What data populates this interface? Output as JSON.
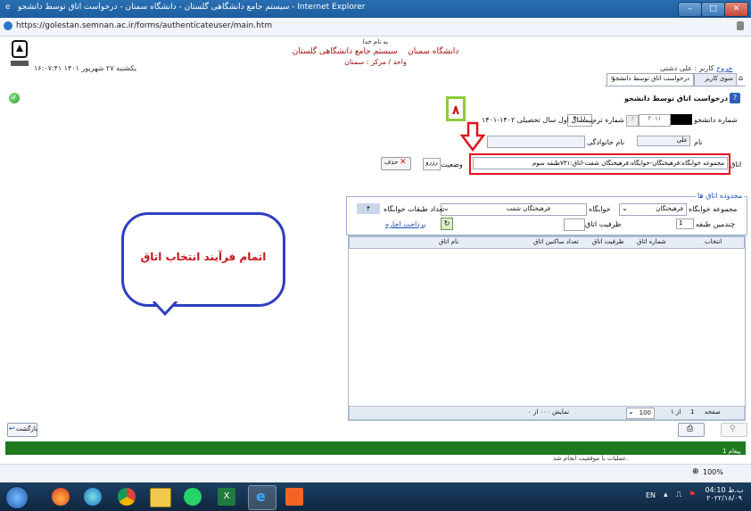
{
  "window": {
    "title": "سیستم جامع دانشگاهی گلستان - دانشگاه سمنان - درخواست اتاق توسط دانشجو - Internet Explorer",
    "url": "https://golestan.semnan.ac.ir/forms/authenticateuser/main.htm",
    "url_host": "golestan.semnan.ac.ir"
  },
  "header": {
    "bismillah": "به نام خدا",
    "system_name": "سیستم جامع دانشگاهی گلستان",
    "university": "دانشگاه سمنان",
    "unit": "واحد / مرکز : سمنان",
    "datetime": "۱۶:۰۷:۴۱ یکشنبه ۲۷ شهریور ۱۴۰۱"
  },
  "user_bar": {
    "user_label": "کاربر : علی دشتی",
    "logout": "خروج"
  },
  "tabs": [
    {
      "label": "منوی کاربر"
    },
    {
      "label": "درخواست اتاق توسط دانشجو"
    }
  ],
  "form": {
    "title": "درخواست اتاق توسط دانشجو",
    "student_number_label": "شماره دانشجو",
    "student_number_value": "۲۰۱۱",
    "term_label": "شماره ترم",
    "term_value": "۴۰۱۱",
    "term_desc": "نیمسال اول سال تحصیلی ۱۴۰۲-۱۴۰۱",
    "first_name_label": "نام",
    "first_name_value": "علی",
    "last_name_label": "نام خانوادگی",
    "last_name_value": "",
    "room_select_label": "اتاق انتخاب شده",
    "room_select_value": "مجموعه خوابگاه:فرهیختگان-خوابگاه:فرهیختگان شفت-اتاق:۷۳۱طبقه سوم",
    "status_label": "وضعیت",
    "status_value": "رزرو",
    "delete_button": "حذف",
    "step_number": "۸"
  },
  "room_area": {
    "legend": "محدوده اتاق ها",
    "dorm_group_label": "مجموعه خوابگاه",
    "dorm_group_value": "فرهیختگان",
    "dorm_label": "خوابگاه",
    "dorm_value": "فرهیختگان شفت",
    "floors_label": "تعداد طبقات خوابگاه",
    "floors_value": "۴",
    "floor_label": "چندمین طبقه",
    "floor_value": "1",
    "capacity_label": "ظرفیت اتاق",
    "capacity_value": "",
    "rent_link": "پرداخت اجاره"
  },
  "grid": {
    "columns": [
      "انتخاب",
      "شماره اتاق",
      "ظرفیت اتاق",
      "تعداد ساکنین اتاق",
      "نام اتاق"
    ],
    "page_label": "صفحه",
    "page_current": "1",
    "page_of": "از ۱",
    "page_size": "100",
    "showing": "نمایش ۰۰۰ از ۰"
  },
  "bubble_text": "اتمام فرآیند انتخاب اتاق",
  "bottom_buttons": {
    "back": "بازگشت",
    "print": "",
    "search": ""
  },
  "messages": {
    "count_label": "1 پیغام",
    "text": "عملیات با موفقیت انجام شد."
  },
  "ie_status": {
    "zoom": "100%"
  },
  "taskbar": {
    "lang": "EN",
    "time": "04:10 ب.ظ",
    "date": "۲۰۲۲/۱۸/۰۹"
  }
}
